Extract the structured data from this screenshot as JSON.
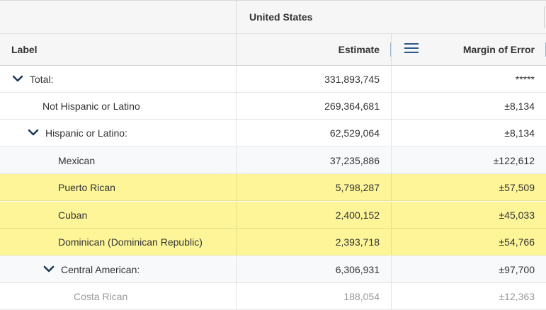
{
  "header": {
    "geography": "United States",
    "col_label": "Label",
    "col_estimate": "Estimate",
    "col_moe": "Margin of Error"
  },
  "rows": [
    {
      "label": "Total:",
      "estimate": "331,893,745",
      "moe": "*****",
      "expandable": true,
      "indent": 0,
      "highlight": false
    },
    {
      "label": "Not Hispanic or Latino",
      "estimate": "269,364,681",
      "moe": "±8,134",
      "expandable": false,
      "indent": 1,
      "highlight": false
    },
    {
      "label": "Hispanic or Latino:",
      "estimate": "62,529,064",
      "moe": "±8,134",
      "expandable": true,
      "indent": 1,
      "highlight": false
    },
    {
      "label": "Mexican",
      "estimate": "37,235,886",
      "moe": "±122,612",
      "expandable": false,
      "indent": 2,
      "highlight": false
    },
    {
      "label": "Puerto Rican",
      "estimate": "5,798,287",
      "moe": "±57,509",
      "expandable": false,
      "indent": 2,
      "highlight": true
    },
    {
      "label": "Cuban",
      "estimate": "2,400,152",
      "moe": "±45,033",
      "expandable": false,
      "indent": 2,
      "highlight": true
    },
    {
      "label": "Dominican (Dominican Republic)",
      "estimate": "2,393,718",
      "moe": "±54,766",
      "expandable": false,
      "indent": 2,
      "highlight": true
    },
    {
      "label": "Central American:",
      "estimate": "6,306,931",
      "moe": "±97,700",
      "expandable": true,
      "indent": 2,
      "highlight": false
    },
    {
      "label": "Costa Rican",
      "estimate": "188,054",
      "moe": "±12,363",
      "expandable": false,
      "indent": 3,
      "highlight": false
    }
  ],
  "colors": {
    "highlight": "#fdf598",
    "chevron": "#1f3a5a"
  }
}
